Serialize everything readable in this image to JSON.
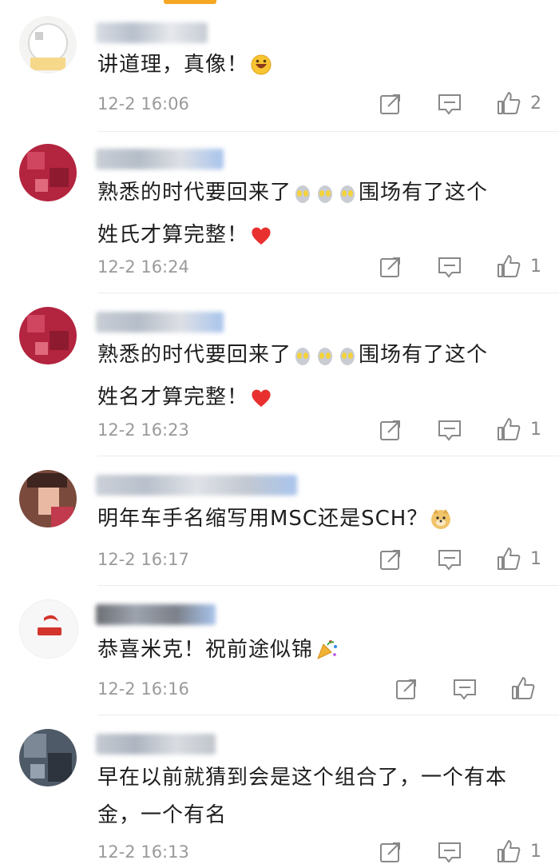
{
  "comments": [
    {
      "text": "讲道理，真像！",
      "time": "12-2 16:06",
      "likes": "2"
    },
    {
      "text_line1": "熟悉的时代要回来了",
      "text_line1_after": "围场有了这个",
      "text_line2": "姓氏才算完整！",
      "time": "12-2 16:24",
      "likes": "1"
    },
    {
      "text_line1": "熟悉的时代要回来了",
      "text_line1_after": "围场有了这个",
      "text_line2": "姓名才算完整！",
      "time": "12-2 16:23",
      "likes": "1"
    },
    {
      "text": "明年车手名缩写用MSC还是SCH？",
      "time": "12-2 16:17",
      "likes": "1"
    },
    {
      "text": "恭喜米克！祝前途似锦",
      "time": "12-2 16:16",
      "likes": ""
    },
    {
      "text_line1": "早在以前就猜到会是这个组合了，一个有本",
      "text_line2": "金，一个有名",
      "time": "12-2 16:13",
      "likes": "1"
    }
  ],
  "colors": {
    "accent": "#f5a623",
    "time": "#9a9a9a",
    "heart": "#e8302e"
  },
  "icons": [
    "share-icon",
    "comment-icon",
    "like-icon"
  ]
}
